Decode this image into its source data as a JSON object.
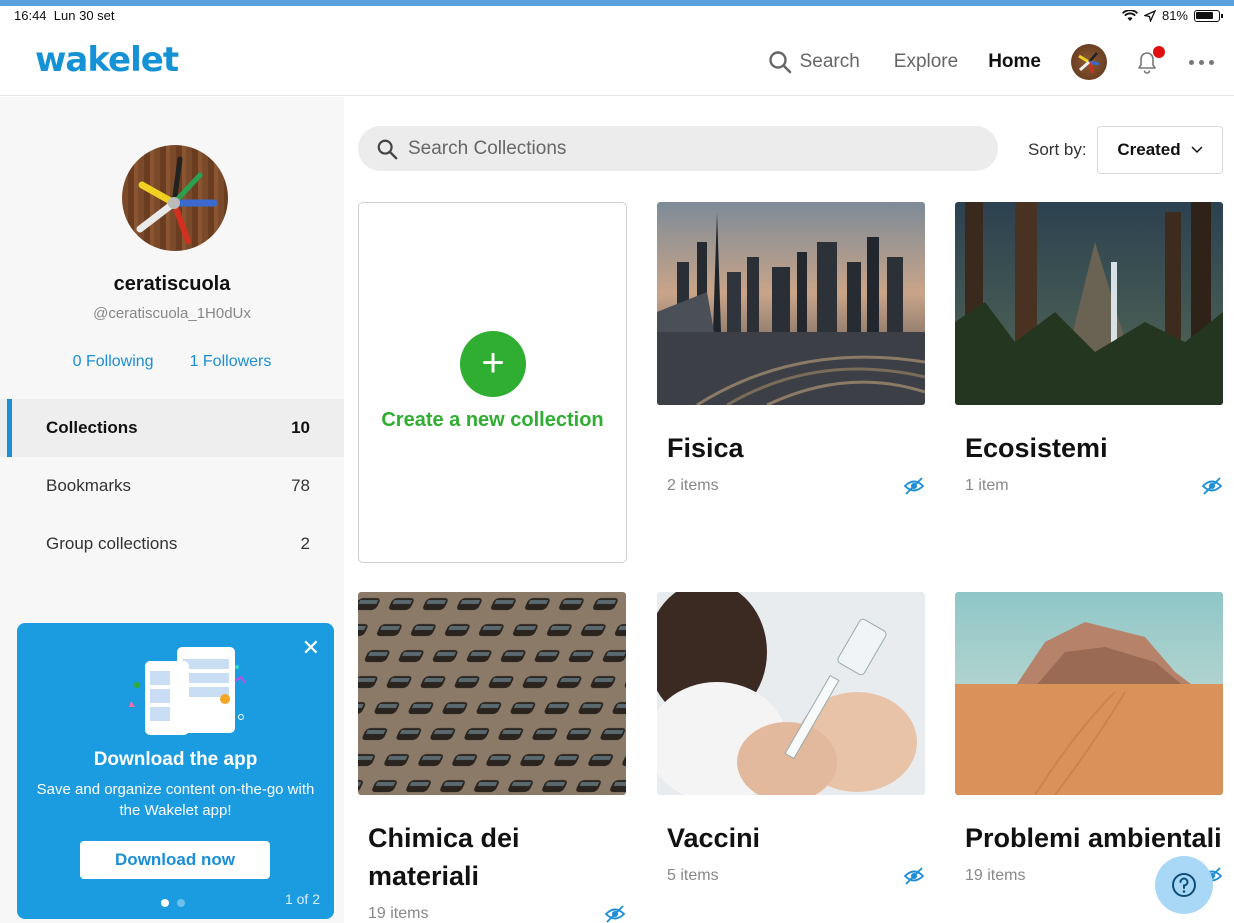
{
  "status": {
    "time": "16:44",
    "date": "Lun 30 set",
    "battery": "81%"
  },
  "header": {
    "logo": "wakelet",
    "nav_search": "Search",
    "nav_explore": "Explore",
    "nav_home": "Home"
  },
  "profile": {
    "name": "ceratiscuola",
    "handle": "@ceratiscuola_1H0dUx",
    "following": "0 Following",
    "followers": "1 Followers"
  },
  "sidebar": {
    "items": [
      {
        "label": "Collections",
        "count": "10"
      },
      {
        "label": "Bookmarks",
        "count": "78"
      },
      {
        "label": "Group collections",
        "count": "2"
      }
    ]
  },
  "promo": {
    "close": "✕",
    "title": "Download the app",
    "text": "Save and organize content on-the-go with the Wakelet app!",
    "button": "Download now",
    "page": "1 of 2"
  },
  "main": {
    "search_placeholder": "Search Collections",
    "sort_label": "Sort by:",
    "sort_value": "Created",
    "create_label": "Create a new collection",
    "create_plus": "+"
  },
  "collections": [
    {
      "title": "Fisica",
      "meta": "2 items"
    },
    {
      "title": "Ecosistemi",
      "meta": "1 item"
    },
    {
      "title": "Chimica dei materiali",
      "meta": "19 items"
    },
    {
      "title": "Vaccini",
      "meta": "5 items"
    },
    {
      "title": "Problemi ambientali",
      "meta": "19 items"
    }
  ],
  "colors": {
    "accent": "#1b8ed6",
    "create_green": "#2fae31",
    "promo_bg": "#1b9be0"
  }
}
